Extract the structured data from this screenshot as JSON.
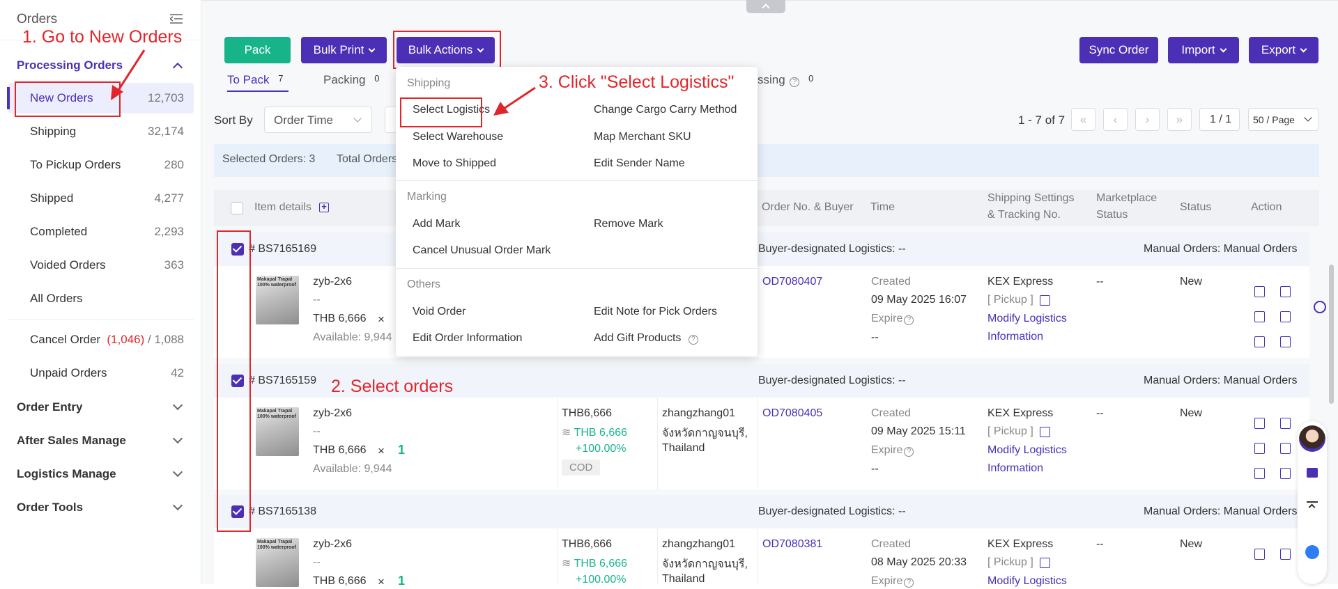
{
  "sidebar": {
    "title": "Orders",
    "group_processing": "Processing Orders",
    "items": [
      {
        "label": "New Orders",
        "count": "12,703"
      },
      {
        "label": "Shipping",
        "count": "32,174"
      },
      {
        "label": "To Pickup Orders",
        "count": "280"
      },
      {
        "label": "Shipped",
        "count": "4,277"
      },
      {
        "label": "Completed",
        "count": "2,293"
      },
      {
        "label": "Voided Orders",
        "count": "363"
      },
      {
        "label": "All Orders",
        "count": ""
      }
    ],
    "cancel_order": {
      "label": "Cancel Order",
      "red": "(1,046)",
      "sep": "/",
      "total": "1,088"
    },
    "unpaid_orders": {
      "label": "Unpaid Orders",
      "count": "42"
    },
    "groups": [
      "Order Entry",
      "After Sales Manage",
      "Logistics Manage",
      "Order Tools"
    ]
  },
  "toolbar": {
    "pack": "Pack",
    "bulk_print": "Bulk Print",
    "bulk_actions": "Bulk Actions",
    "sync_order": "Sync Order",
    "import": "Import",
    "export": "Export"
  },
  "tabs": [
    {
      "label": "To Pack",
      "count": "7"
    },
    {
      "label": "Packing",
      "count": "0"
    },
    {
      "label": "ssing",
      "count": "0"
    }
  ],
  "filter": {
    "sort_by": "Sort By",
    "sort_value": "Order Time",
    "pagination": "1 - 7 of 7",
    "page_input": "1 / 1",
    "per_page": "50 / Page"
  },
  "selection": {
    "selected": "Selected Orders: 3",
    "total": "Total Orders"
  },
  "table_headers": {
    "item_details": "Item details",
    "order_no_buyer": "Order No. & Buyer",
    "time": "Time",
    "shipping_settings_1": "Shipping Settings",
    "shipping_settings_2": "& Tracking No.",
    "marketplace_status_1": "Marketplace",
    "marketplace_status_2": "Status",
    "status": "Status",
    "action": "Action"
  },
  "dropdown": {
    "shipping_title": "Shipping",
    "shipping_left": [
      "Select Logistics",
      "Select Warehouse",
      "Move to Shipped"
    ],
    "shipping_right": [
      "Change Cargo Carry Method",
      "Map Merchant SKU",
      "Edit Sender Name"
    ],
    "marking_title": "Marking",
    "marking_left": [
      "Add Mark",
      "Cancel Unusual Order Mark"
    ],
    "marking_right": [
      "Remove Mark"
    ],
    "others_title": "Others",
    "others_left": [
      "Void Order",
      "Edit Order Information"
    ],
    "others_right": [
      "Edit Note for Pick Orders",
      "Add Gift Products"
    ]
  },
  "orders": [
    {
      "id": "# BS7165169",
      "logistics": "Buyer-designated Logistics: --",
      "manual": "Manual Orders: Manual Orders",
      "product": "zyb-2x6",
      "dash": "--",
      "price": "THB 6,666",
      "qty_x": "×",
      "qty": "",
      "available": "Available: 9,944",
      "amount": "",
      "amount_green": "",
      "percent": "",
      "cod": "",
      "buyer": "",
      "buyer_addr": "",
      "buyer_country": "",
      "order_no": "OD7080407",
      "created": "Created",
      "created_time": "09 May 2025 16:07",
      "expire": "Expire",
      "expire_val": "--",
      "carrier": "KEX Express",
      "pickup": "[ Pickup ]",
      "modify1": "Modify Logistics",
      "modify2": "Information",
      "marketplace_status": "--",
      "status": "New"
    },
    {
      "id": "# BS7165159",
      "logistics": "Buyer-designated Logistics: --",
      "manual": "Manual Orders: Manual Orders",
      "product": "zyb-2x6",
      "dash": "--",
      "price": "THB 6,666",
      "qty_x": "×",
      "qty": "1",
      "available": "Available: 9,944",
      "amount": "THB6,666",
      "amount_green": "THB 6,666",
      "percent": "+100.00%",
      "cod": "COD",
      "buyer": "zhangzhang01",
      "buyer_addr": "จังหวัดกาญจนบุรี,",
      "buyer_country": "Thailand",
      "order_no": "OD7080405",
      "created": "Created",
      "created_time": "09 May 2025 15:11",
      "expire": "Expire",
      "expire_val": "--",
      "carrier": "KEX Express",
      "pickup": "[ Pickup ]",
      "modify1": "Modify Logistics",
      "modify2": "Information",
      "marketplace_status": "--",
      "status": "New"
    },
    {
      "id": "# BS7165138",
      "logistics": "Buyer-designated Logistics: --",
      "manual": "Manual Orders: Manual Orders",
      "product": "zyb-2x6",
      "dash": "--",
      "price": "THB 6,666",
      "qty_x": "×",
      "qty": "1",
      "available": "",
      "amount": "THB6,666",
      "amount_green": "THB 6,666",
      "percent": "+100.00%",
      "cod": "",
      "buyer": "zhangzhang01",
      "buyer_addr": "จังหวัดกาญจนบุรี,",
      "buyer_country": "Thailand",
      "order_no": "OD7080381",
      "created": "Created",
      "created_time": "08 May 2025 20:33",
      "expire": "Expire",
      "expire_val": "",
      "carrier": "KEX Express",
      "pickup": "[ Pickup ]",
      "modify1": "Modify Logistics",
      "modify2": "",
      "marketplace_status": "--",
      "status": "New"
    }
  ],
  "thumb_text": "Makapal Trapal\n100% waterproof",
  "annotations": {
    "step1": "1. Go to New Orders",
    "step2": "2. Select orders",
    "step3": "3. Click \"Select Logistics\""
  },
  "colors": {
    "brand": "#4b2fb5",
    "green": "#17b48a",
    "annotation": "#e0262b"
  }
}
